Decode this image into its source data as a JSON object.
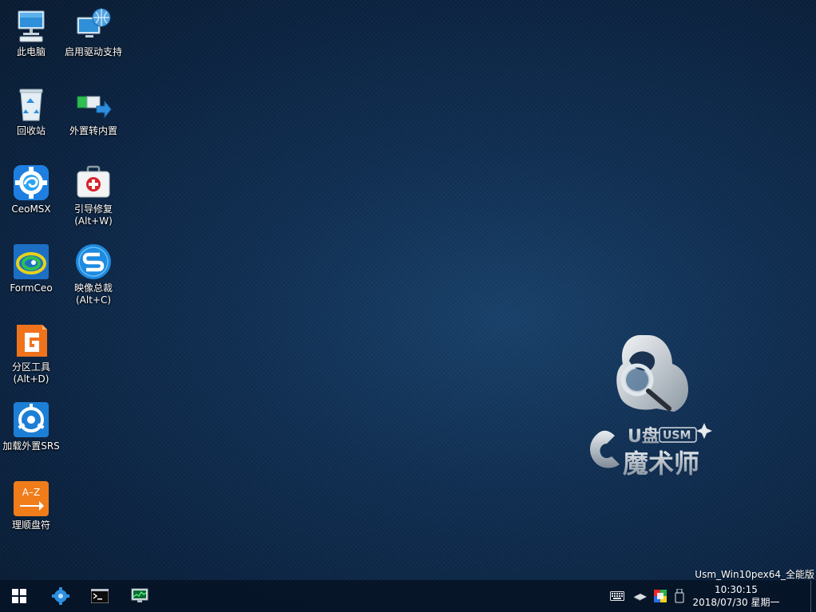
{
  "desktop": {
    "icons": [
      {
        "label": "此电脑",
        "sub": "",
        "icon": "computer-icon"
      },
      {
        "label": "启用驱动支持",
        "sub": "",
        "icon": "network-globe-icon"
      },
      {
        "label": "回收站",
        "sub": "",
        "icon": "recycle-bin-icon"
      },
      {
        "label": "外置转内置",
        "sub": "",
        "icon": "convert-arrow-icon"
      },
      {
        "label": "CeoMSX",
        "sub": "",
        "icon": "gear-swirl-icon"
      },
      {
        "label": "引导修复",
        "sub": "(Alt+W)",
        "icon": "first-aid-kit-icon"
      },
      {
        "label": "FormCeo",
        "sub": "",
        "icon": "swirl-icon"
      },
      {
        "label": "映像总裁",
        "sub": "(Alt+C)",
        "icon": "s-logo-icon"
      },
      {
        "label": "分区工具",
        "sub": "(Alt+D)",
        "icon": "partition-g-icon"
      },
      {
        "label": "加载外置SRS",
        "sub": "",
        "icon": "usb-gear-icon"
      },
      {
        "label": "理顺盘符",
        "sub": "",
        "icon": "a-z-sort-icon"
      }
    ],
    "logo": {
      "top": "U盘",
      "badge": "USM",
      "bottom": "魔术师"
    },
    "version": "Usm_Win10pex64_全能版"
  },
  "taskbar": {
    "apps": [
      "start-windows-icon",
      "gear-puzzle-icon",
      "command-prompt-icon",
      "task-manager-icon"
    ],
    "tray": [
      "keyboard-icon",
      "network-icon",
      "color-palette-icon",
      "usb-drive-icon"
    ],
    "time": "10:30:15",
    "date": "2018/07/30 星期一"
  }
}
